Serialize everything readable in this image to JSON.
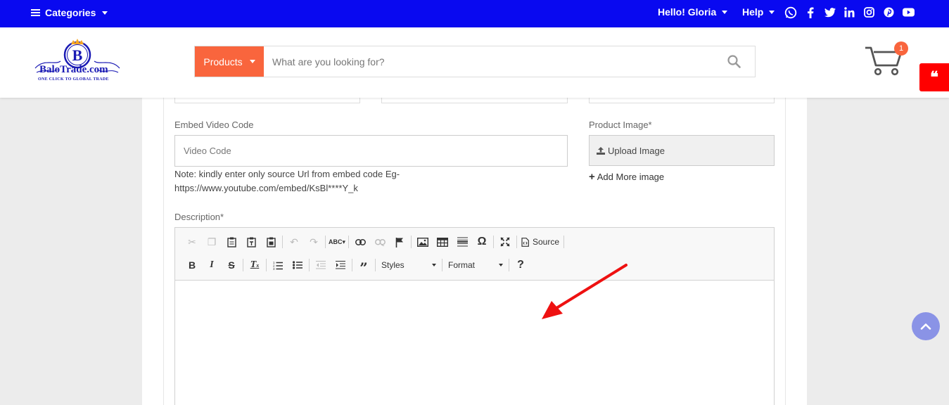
{
  "topbar": {
    "categories_label": "Categories",
    "greeting": "Hello! Gloria",
    "help_label": "Help",
    "social_icons": [
      "whatsapp-icon",
      "facebook-icon",
      "twitter-icon",
      "linkedin-icon",
      "instagram-icon",
      "pinterest-icon",
      "youtube-icon"
    ]
  },
  "header": {
    "logo_text": "BaloTrade.com",
    "logo_tagline": "ONE CLICK TO GLOBAL TRADE",
    "logo_letter": "B",
    "search_category": "Products",
    "search_placeholder": "What are you looking for?",
    "cart_count": "1"
  },
  "form": {
    "video_label": "Embed Video Code",
    "video_placeholder": "Video Code",
    "video_note": "Note: kindly enter only source Url from embed code Eg-https://www.youtube.com/embed/KsBl****Y_k",
    "image_label": "Product Image*",
    "upload_label": "Upload Image",
    "add_more_label": "Add More image",
    "description_label": "Description*"
  },
  "editor": {
    "source_label": "Source",
    "styles_label": "Styles",
    "format_label": "Format"
  },
  "colors": {
    "topbar": "#0909f0",
    "accent": "#f9653d",
    "quote": "#ff0000",
    "annotation_arrow": "#ee1111"
  }
}
